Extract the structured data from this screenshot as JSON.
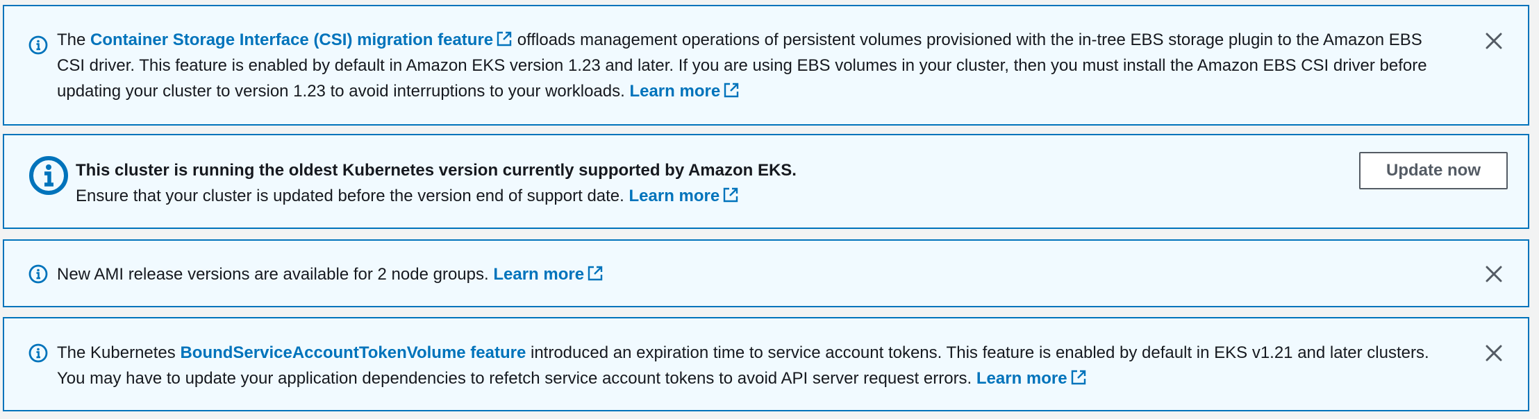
{
  "colors": {
    "accent": "#0073bb",
    "background": "#f1faff",
    "text": "#16191f"
  },
  "alerts": [
    {
      "icon": "info-icon",
      "line1_pre": "The ",
      "line1_link": "Container Storage Interface (CSI) migration feature",
      "line1_post": " offloads management operations of persistent volumes provisioned with the in-tree EBS storage plugin to the Amazon EBS",
      "line2": "CSI driver. This feature is enabled by default in Amazon EKS version 1.23 and later. If you are using EBS volumes in your cluster, then you must install the Amazon EBS CSI driver before",
      "line3": "updating your cluster to version 1.23 to avoid interruptions to your workloads. ",
      "learn_more": "Learn more",
      "dismiss_icon": "close-icon"
    },
    {
      "icon": "info-icon",
      "title": "This cluster is running the oldest Kubernetes version currently supported by Amazon EKS.",
      "line2": "Ensure that your cluster is updated before the version end of support date. ",
      "learn_more": "Learn more",
      "button_label": "Update now"
    },
    {
      "icon": "info-icon",
      "line1": "New AMI release versions are available for 2 node groups. ",
      "learn_more": "Learn more",
      "dismiss_icon": "close-icon"
    },
    {
      "icon": "info-icon",
      "line1_pre": "The Kubernetes ",
      "line1_link": "BoundServiceAccountTokenVolume feature",
      "line1_post": " introduced an expiration time to service account tokens. This feature is enabled by default in EKS v1.21 and later clusters.",
      "line2": "You may have to update your application dependencies to refetch service account tokens to avoid API server request errors. ",
      "learn_more": "Learn more",
      "dismiss_icon": "close-icon"
    }
  ]
}
